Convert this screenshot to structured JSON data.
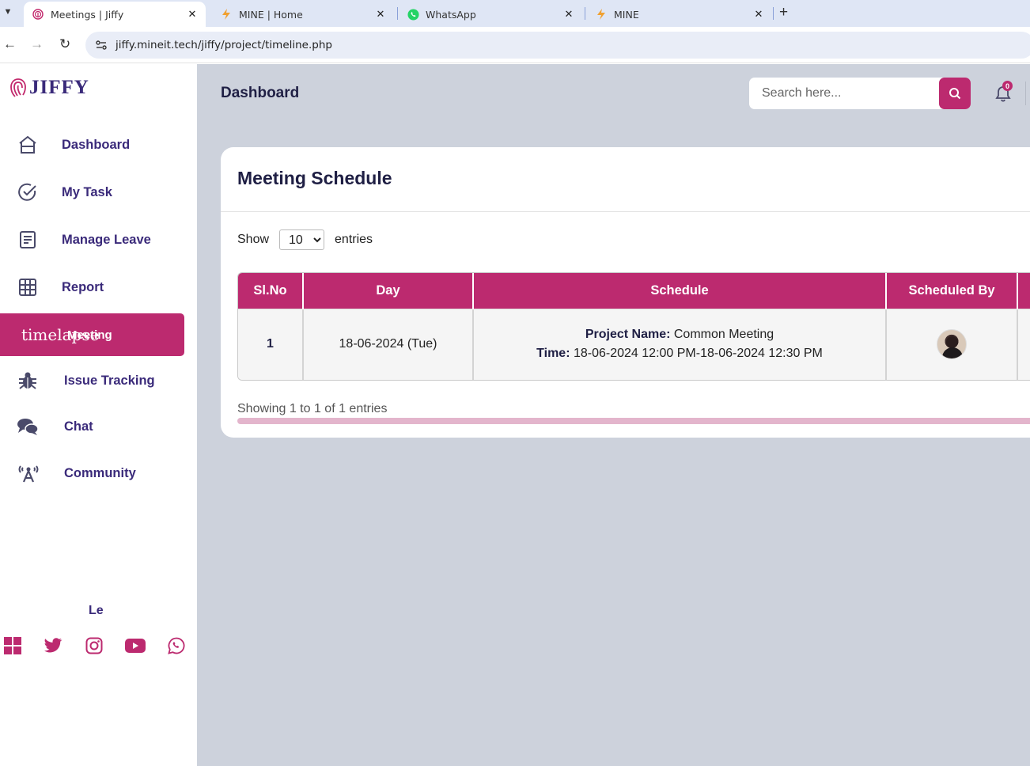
{
  "browser": {
    "tabs": [
      {
        "title": "Meetings | Jiffy",
        "active": true,
        "icon": "jiffy-fingerprint-icon"
      },
      {
        "title": "MINE | Home",
        "active": false,
        "icon": "bolt-icon"
      },
      {
        "title": "WhatsApp",
        "active": false,
        "icon": "whatsapp-icon"
      },
      {
        "title": "MINE",
        "active": false,
        "icon": "bolt-icon"
      }
    ],
    "url": "jiffy.mineit.tech/jiffy/project/timeline.php"
  },
  "sidebar": {
    "logo_text": "JIFFY",
    "items": [
      {
        "label": "Dashboard",
        "icon": "home-icon"
      },
      {
        "label": "My Task",
        "icon": "check-circle-icon"
      },
      {
        "label": "Manage Leave",
        "icon": "document-icon"
      },
      {
        "label": "Report",
        "icon": "grid-icon"
      },
      {
        "label": "Meeting",
        "icon": "timelapse-icon",
        "active": true
      },
      {
        "label": "Issue Tracking",
        "icon": "bug-icon"
      },
      {
        "label": "Chat",
        "icon": "chat-icon"
      },
      {
        "label": "Community",
        "icon": "broadcast-icon"
      }
    ],
    "timelapse_text": "timelapse",
    "footer_label": "Le",
    "social": [
      "windows-icon",
      "twitter-icon",
      "instagram-icon",
      "youtube-icon",
      "whatsapp-icon"
    ]
  },
  "header": {
    "title": "Dashboard",
    "search_placeholder": "Search here...",
    "notification_count": "0"
  },
  "card": {
    "title": "Meeting Schedule",
    "show_label": "Show",
    "entries_value": "10",
    "entries_label": "entries",
    "columns": [
      "Sl.No",
      "Day",
      "Schedule",
      "Scheduled By"
    ],
    "rows": [
      {
        "sl_no": "1",
        "day": "18-06-2024 (Tue)",
        "project_label": "Project Name:",
        "project_name": "Common Meeting",
        "time_label": "Time:",
        "time_value": "18-06-2024 12:00 PM-18-06-2024 12:30 PM"
      }
    ],
    "showing_text": "Showing 1 to 1 of 1 entries"
  },
  "colors": {
    "accent": "#bc2a6f",
    "navy": "#3a2a7a",
    "main_bg": "#cdd2dc"
  }
}
